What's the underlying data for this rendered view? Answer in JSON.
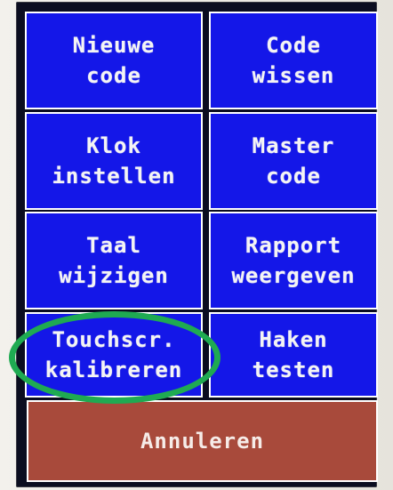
{
  "menu": {
    "buttons": [
      {
        "line1": "Nieuwe",
        "line2": "code"
      },
      {
        "line1": "Code",
        "line2": "wissen"
      },
      {
        "line1": "Klok",
        "line2": "instellen"
      },
      {
        "line1": "Master",
        "line2": "code"
      },
      {
        "line1": "Taal",
        "line2": "wijzigen"
      },
      {
        "line1": "Rapport",
        "line2": "weergeven"
      },
      {
        "line1": "Touchscr.",
        "line2": "kalibreren"
      },
      {
        "line1": "Haken",
        "line2": "testen"
      }
    ],
    "cancel_label": "Annuleren"
  },
  "colors": {
    "button_blue": "#1417e8",
    "cancel_red": "#a84a3b",
    "highlight_green": "#1faa52"
  }
}
